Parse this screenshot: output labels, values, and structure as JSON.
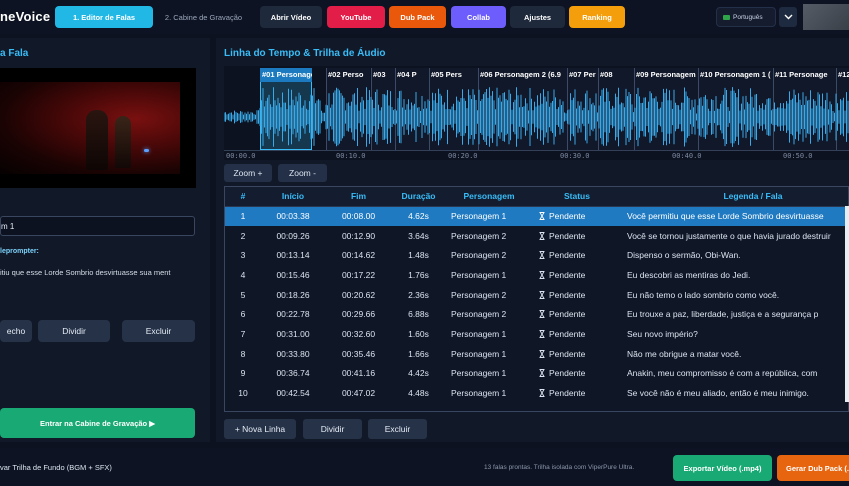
{
  "app": {
    "brand": "neVoice"
  },
  "nav": {
    "editor_tab": "1. Editor de Falas",
    "booth_tab": "2. Cabine de Gravação",
    "open_video": "Abrir Vídeo",
    "youtube": "YouTube",
    "dub_pack": "Dub Pack",
    "collab": "Collab",
    "settings": "Ajustes",
    "ranking": "Ranking",
    "language": "Português",
    "colors": {
      "cyan": "#22b8e6",
      "red": "#e11d48",
      "orange": "#ea580c",
      "purple": "#6d5dfc",
      "amber": "#f59e0b",
      "dark": "#1e293b"
    }
  },
  "left": {
    "title": "a Fala",
    "character_value": "m 1",
    "teleprompter_label": "leprompter:",
    "teleprompter_text": "itiu que esse Lorde Sombrio desvirtuasse sua ment",
    "btn_cut": "echo",
    "btn_split": "Dividir",
    "btn_delete": "Excluir",
    "btn_enter_booth": "Entrar na Cabine de Gravação ▶"
  },
  "timeline": {
    "title": "Linha do Tempo & Trilha de Áudio",
    "segments": [
      "#01 Personagem",
      "#02 Perso",
      "#03",
      "#04 P",
      "#05 Pers",
      "#06 Personagem 2 (6.9",
      "#07 Per",
      "#08",
      "#09 Personagem",
      "#10 Personagem 1 (",
      "#11 Personage",
      "#12"
    ],
    "ticks": [
      "00:00.0",
      "00:10.0",
      "00:20.0",
      "00:30.0",
      "00:40.0",
      "00:50.0"
    ],
    "zoom_in": "Zoom +",
    "zoom_out": "Zoom -"
  },
  "table": {
    "headers": [
      "#",
      "Início",
      "Fim",
      "Duração",
      "Personagem",
      "Status",
      "Legenda / Fala"
    ],
    "rows": [
      [
        "1",
        "00:03.38",
        "00:08.00",
        "4.62s",
        "Personagem 1",
        "Pendente",
        "Você permitiu que esse Lorde Sombrio desvirtuasse"
      ],
      [
        "2",
        "00:09.26",
        "00:12.90",
        "3.64s",
        "Personagem 2",
        "Pendente",
        "Você se tornou justamente o que havia jurado destruir"
      ],
      [
        "3",
        "00:13.14",
        "00:14.62",
        "1.48s",
        "Personagem 2",
        "Pendente",
        "Dispenso o sermão, Obi-Wan."
      ],
      [
        "4",
        "00:15.46",
        "00:17.22",
        "1.76s",
        "Personagem 1",
        "Pendente",
        "Eu descobri as mentiras do Jedi."
      ],
      [
        "5",
        "00:18.26",
        "00:20.62",
        "2.36s",
        "Personagem 2",
        "Pendente",
        "Eu não temo o lado sombrio como você."
      ],
      [
        "6",
        "00:22.78",
        "00:29.66",
        "6.88s",
        "Personagem 2",
        "Pendente",
        "Eu trouxe a paz, liberdade, justiça e a segurança p"
      ],
      [
        "7",
        "00:31.00",
        "00:32.60",
        "1.60s",
        "Personagem 1",
        "Pendente",
        "Seu novo império?"
      ],
      [
        "8",
        "00:33.80",
        "00:35.46",
        "1.66s",
        "Personagem 1",
        "Pendente",
        "Não me obrigue a matar você."
      ],
      [
        "9",
        "00:36.74",
        "00:41.16",
        "4.42s",
        "Personagem 1",
        "Pendente",
        "Anakin, meu compromisso é com a república, com"
      ],
      [
        "10",
        "00:42.54",
        "00:47.02",
        "4.48s",
        "Personagem 1",
        "Pendente",
        "Se você não é meu aliado, então é meu inimigo."
      ]
    ],
    "btn_new_line": "+ Nova Linha",
    "btn_split": "Dividir",
    "btn_delete": "Excluir"
  },
  "footer": {
    "bgm_text": "var Trilha de Fundo (BGM + SFX)",
    "status_text": "13 falas prontas. Trilha isolada com ViperPure Ultra.",
    "export_video": "Exportar Vídeo (.mp4)",
    "gen_dub_pack": "Gerar Dub Pack (.z"
  }
}
